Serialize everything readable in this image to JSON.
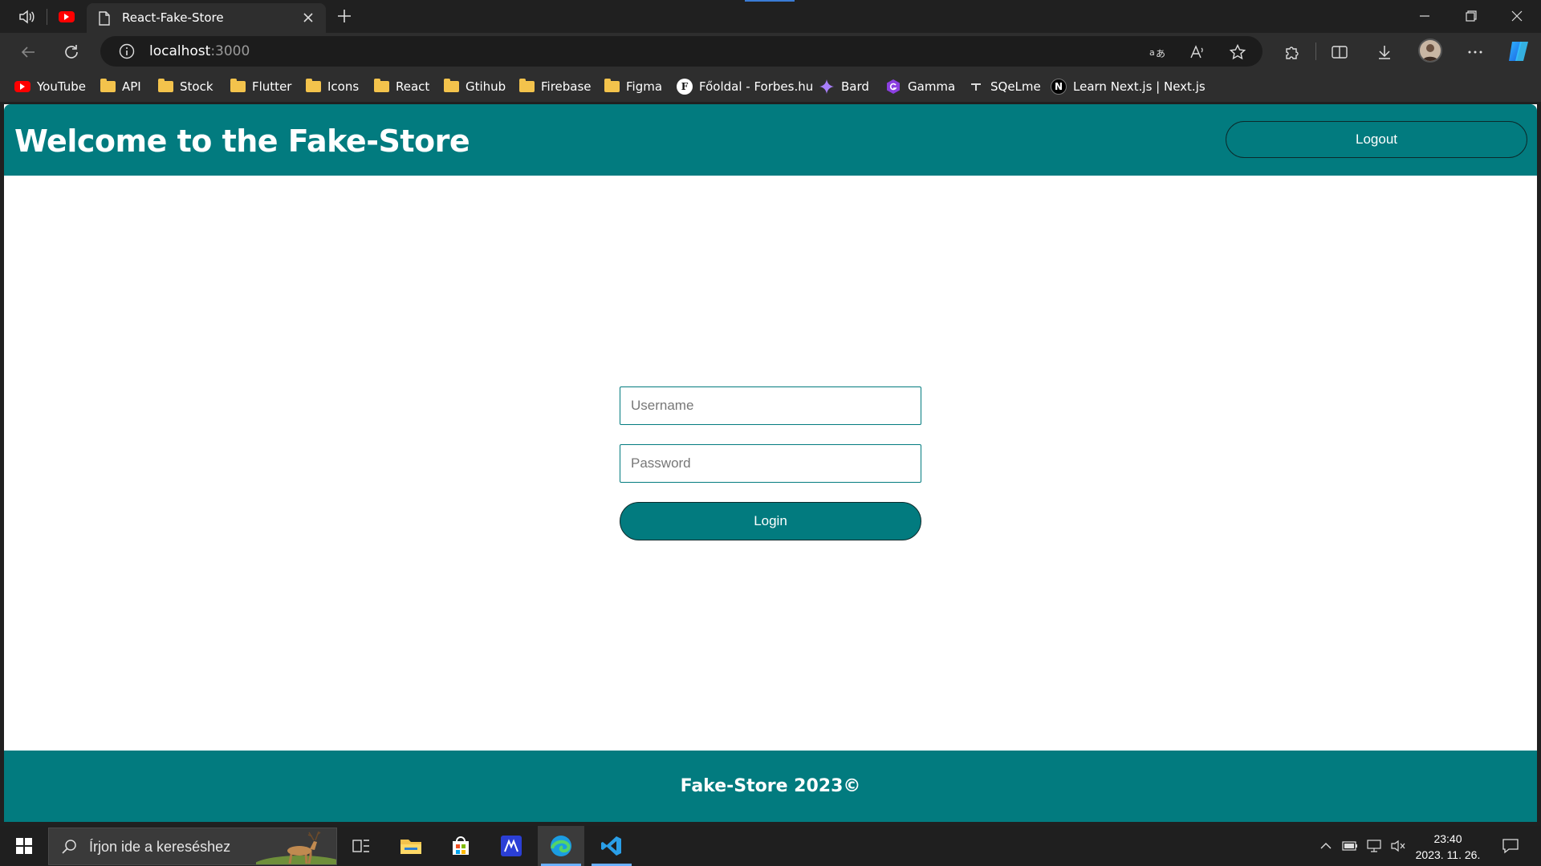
{
  "browser": {
    "tab_title": "React-Fake-Store",
    "url_host": "localhost",
    "url_port": ":3000",
    "bookmarks": [
      {
        "label": "YouTube",
        "icon": "youtube-icon"
      },
      {
        "label": "API",
        "icon": "folder-icon"
      },
      {
        "label": "Stock",
        "icon": "folder-icon"
      },
      {
        "label": "Flutter",
        "icon": "folder-icon"
      },
      {
        "label": "Icons",
        "icon": "folder-icon"
      },
      {
        "label": "React",
        "icon": "folder-icon"
      },
      {
        "label": "Gtihub",
        "icon": "folder-icon"
      },
      {
        "label": "Firebase",
        "icon": "folder-icon"
      },
      {
        "label": "Figma",
        "icon": "folder-icon"
      },
      {
        "label": "Főoldal - Forbes.hu",
        "icon": "forbes-icon"
      },
      {
        "label": "Bard",
        "icon": "bard-icon"
      },
      {
        "label": "Gamma",
        "icon": "gamma-icon"
      },
      {
        "label": "SQeLme",
        "icon": "sqelme-icon"
      },
      {
        "label": "Learn Next.js | Next.js",
        "icon": "nextjs-icon"
      }
    ]
  },
  "site": {
    "title": "Welcome to the Fake-Store",
    "logout_label": "Logout",
    "username_placeholder": "Username",
    "password_placeholder": "Password",
    "login_label": "Login",
    "footer_text": "Fake-Store 2023©"
  },
  "taskbar": {
    "search_placeholder": "Írjon ide a kereséshez",
    "time": "23:40",
    "date": "2023. 11. 26."
  },
  "colors": {
    "brand_teal": "#027b7f",
    "browser_dark": "#202020",
    "bookmark_folder": "#f3c34c",
    "accent_blue": "#3a7bd5"
  }
}
